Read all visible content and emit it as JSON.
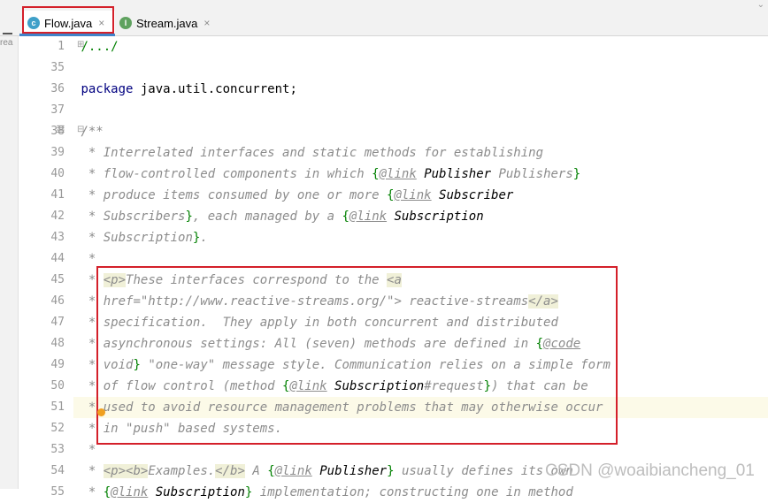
{
  "tabs": [
    {
      "label": "Flow.java",
      "close": "×",
      "icon_letter": "c",
      "icon_color": "#3fa0c9",
      "active": true
    },
    {
      "label": "Stream.java",
      "close": "×",
      "icon_letter": "I",
      "icon_color": "#5fa25f",
      "active": false
    }
  ],
  "left_strip_label": "rea",
  "watermark": "CSDN @woaibiancheng_01",
  "colors": {
    "accent": "#d4202a",
    "keyword": "#000080",
    "comment": "#8c8c8c",
    "brace": "#008000"
  },
  "lines": [
    {
      "n": "1",
      "segs": [
        {
          "t": "/...",
          "c": "br"
        },
        {
          "t": "/",
          "c": "br"
        }
      ]
    },
    {
      "n": "35",
      "segs": []
    },
    {
      "n": "36",
      "segs": [
        {
          "t": "package ",
          "c": "kw"
        },
        {
          "t": "java.util.concurrent;",
          "c": ""
        }
      ]
    },
    {
      "n": "37",
      "segs": []
    },
    {
      "n": "38",
      "segs": [
        {
          "t": "/**",
          "c": "cm"
        }
      ]
    },
    {
      "n": "39",
      "segs": [
        {
          "t": " * Interrelated interfaces and static methods for establishing",
          "c": "cm"
        }
      ]
    },
    {
      "n": "40",
      "segs": [
        {
          "t": " * flow-controlled components in which ",
          "c": "cm"
        },
        {
          "t": "{",
          "c": "br"
        },
        {
          "t": "@link",
          "c": "lk"
        },
        {
          "t": " Publisher",
          "c": "ref"
        },
        {
          "t": " Publishers",
          "c": "cm"
        },
        {
          "t": "}",
          "c": "br"
        }
      ]
    },
    {
      "n": "41",
      "segs": [
        {
          "t": " * produce items consumed by one or more ",
          "c": "cm"
        },
        {
          "t": "{",
          "c": "br"
        },
        {
          "t": "@link",
          "c": "lk"
        },
        {
          "t": " Subscriber",
          "c": "ref"
        }
      ]
    },
    {
      "n": "42",
      "segs": [
        {
          "t": " * Subscribers",
          "c": "cm"
        },
        {
          "t": "}",
          "c": "br"
        },
        {
          "t": ", each managed by a ",
          "c": "cm"
        },
        {
          "t": "{",
          "c": "br"
        },
        {
          "t": "@link",
          "c": "lk"
        },
        {
          "t": " Subscription",
          "c": "ref"
        }
      ]
    },
    {
      "n": "43",
      "segs": [
        {
          "t": " * Subscription",
          "c": "cm"
        },
        {
          "t": "}",
          "c": "br"
        },
        {
          "t": ".",
          "c": "cm"
        }
      ]
    },
    {
      "n": "44",
      "segs": [
        {
          "t": " *",
          "c": "cm"
        }
      ]
    },
    {
      "n": "45",
      "segs": [
        {
          "t": " * ",
          "c": "cm"
        },
        {
          "t": "<p>",
          "c": "tg"
        },
        {
          "t": "These interfaces correspond to the ",
          "c": "cm"
        },
        {
          "t": "<a",
          "c": "tg"
        }
      ]
    },
    {
      "n": "46",
      "segs": [
        {
          "t": " * ",
          "c": "cm"
        },
        {
          "t": "href=\"http://www.reactive-streams.org/\">",
          "c": "tgb"
        },
        {
          "t": " reactive-streams",
          "c": "cm"
        },
        {
          "t": "</a>",
          "c": "tg"
        }
      ]
    },
    {
      "n": "47",
      "segs": [
        {
          "t": " * specification.  They apply in both concurrent and distributed",
          "c": "cm"
        }
      ]
    },
    {
      "n": "48",
      "segs": [
        {
          "t": " * asynchronous settings: All (seven) methods are defined in ",
          "c": "cm"
        },
        {
          "t": "{",
          "c": "br"
        },
        {
          "t": "@code",
          "c": "lk"
        }
      ]
    },
    {
      "n": "49",
      "segs": [
        {
          "t": " * void",
          "c": "cm"
        },
        {
          "t": "}",
          "c": "br"
        },
        {
          "t": " \"one-way\" message style. Communication relies on a simple form",
          "c": "cm"
        }
      ]
    },
    {
      "n": "50",
      "segs": [
        {
          "t": " * of flow control (method ",
          "c": "cm"
        },
        {
          "t": "{",
          "c": "br"
        },
        {
          "t": "@link",
          "c": "lk"
        },
        {
          "t": " Subscription",
          "c": "ref"
        },
        {
          "t": "#request",
          "c": "cm"
        },
        {
          "t": "}",
          "c": "br"
        },
        {
          "t": ") that can be",
          "c": "cm"
        }
      ]
    },
    {
      "n": "51",
      "segs": [
        {
          "t": " * used to avoid resource management problems that may otherwise occur",
          "c": "cm"
        }
      ],
      "hl": true
    },
    {
      "n": "52",
      "segs": [
        {
          "t": " * in \"push\" based systems.",
          "c": "cm"
        }
      ]
    },
    {
      "n": "53",
      "segs": [
        {
          "t": " *",
          "c": "cm"
        }
      ]
    },
    {
      "n": "54",
      "segs": [
        {
          "t": " * ",
          "c": "cm"
        },
        {
          "t": "<p><b>",
          "c": "tg"
        },
        {
          "t": "Examples.",
          "c": "cm"
        },
        {
          "t": "</b>",
          "c": "tg"
        },
        {
          "t": " A ",
          "c": "cm"
        },
        {
          "t": "{",
          "c": "br"
        },
        {
          "t": "@link",
          "c": "lk"
        },
        {
          "t": " Publisher",
          "c": "ref"
        },
        {
          "t": "}",
          "c": "br"
        },
        {
          "t": " usually defines its own",
          "c": "cm"
        }
      ]
    },
    {
      "n": "55",
      "segs": [
        {
          "t": " * ",
          "c": "cm"
        },
        {
          "t": "{",
          "c": "br"
        },
        {
          "t": "@link",
          "c": "lk"
        },
        {
          "t": " Subscription",
          "c": "ref"
        },
        {
          "t": "}",
          "c": "br"
        },
        {
          "t": " implementation; constructing one in method",
          "c": "cm"
        }
      ]
    }
  ]
}
